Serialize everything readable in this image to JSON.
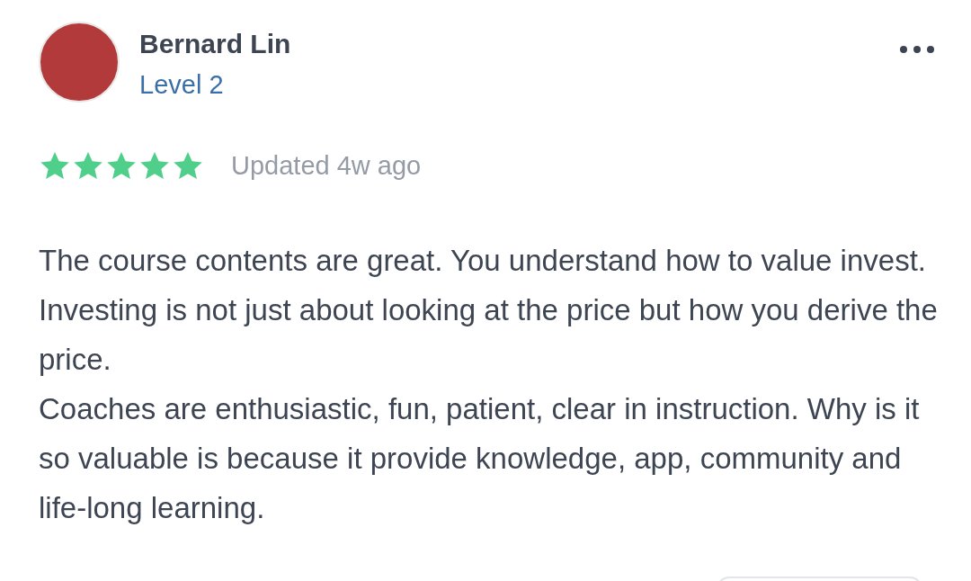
{
  "review": {
    "author": "Bernard Lin",
    "level": "Level 2",
    "stars": 5,
    "updated": "Updated 4w ago",
    "paragraphs": [
      "The course contents are great. You understand how to value invest. Investing is not just about looking at the price but how you derive the price.",
      "Coaches are enthusiastic, fun, patient, clear in instruction. Why is it so valuable is because it provide knowledge, app, community and life-long learning."
    ]
  }
}
